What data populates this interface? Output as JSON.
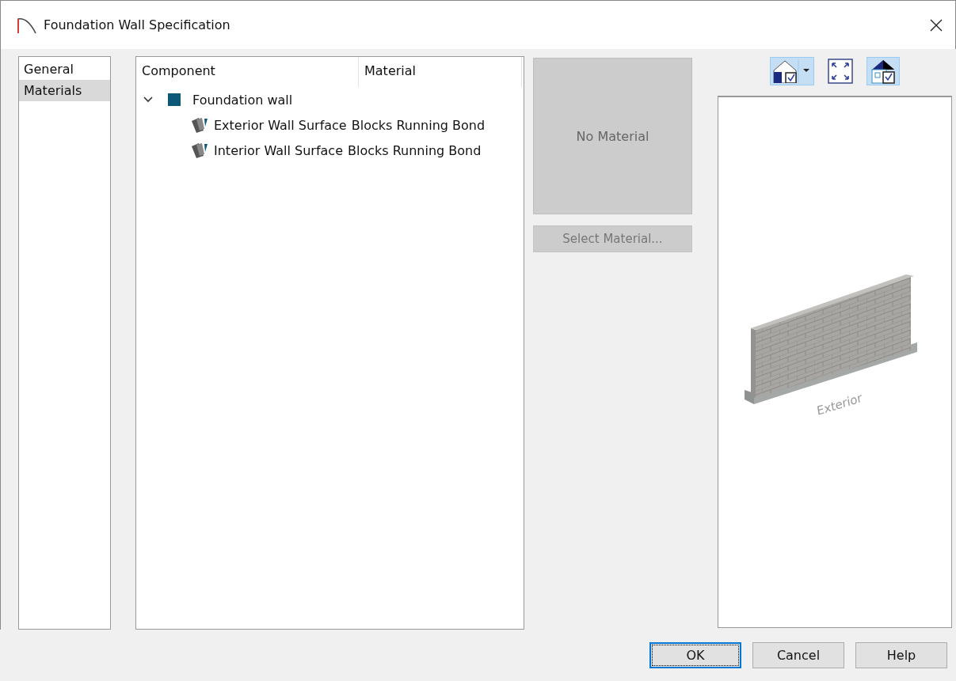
{
  "window": {
    "title": "Foundation Wall Specification"
  },
  "sidebar": {
    "items": [
      {
        "label": "General",
        "selected": false
      },
      {
        "label": "Materials",
        "selected": true
      }
    ]
  },
  "tree": {
    "columns": [
      "Component",
      "Material"
    ],
    "rows": [
      {
        "component": "Foundation wall",
        "expanded": true,
        "children": [
          {
            "component": "Exterior Wall Surface",
            "material": "Blocks Running Bond"
          },
          {
            "component": "Interior Wall Surface",
            "material": "Blocks Running Bond"
          }
        ]
      }
    ]
  },
  "material_panel": {
    "swatch_text": "No Material",
    "select_button": {
      "label": "Select Material...",
      "disabled": true
    }
  },
  "preview": {
    "toolbar": [
      {
        "kind": "view",
        "on": true
      },
      {
        "kind": "fit",
        "on": false
      },
      {
        "kind": "layers",
        "on": true
      }
    ],
    "label": "Exterior"
  },
  "buttons": [
    {
      "label": "OK",
      "default": true
    },
    {
      "label": "Cancel",
      "default": false
    },
    {
      "label": "Help",
      "default": false
    }
  ]
}
